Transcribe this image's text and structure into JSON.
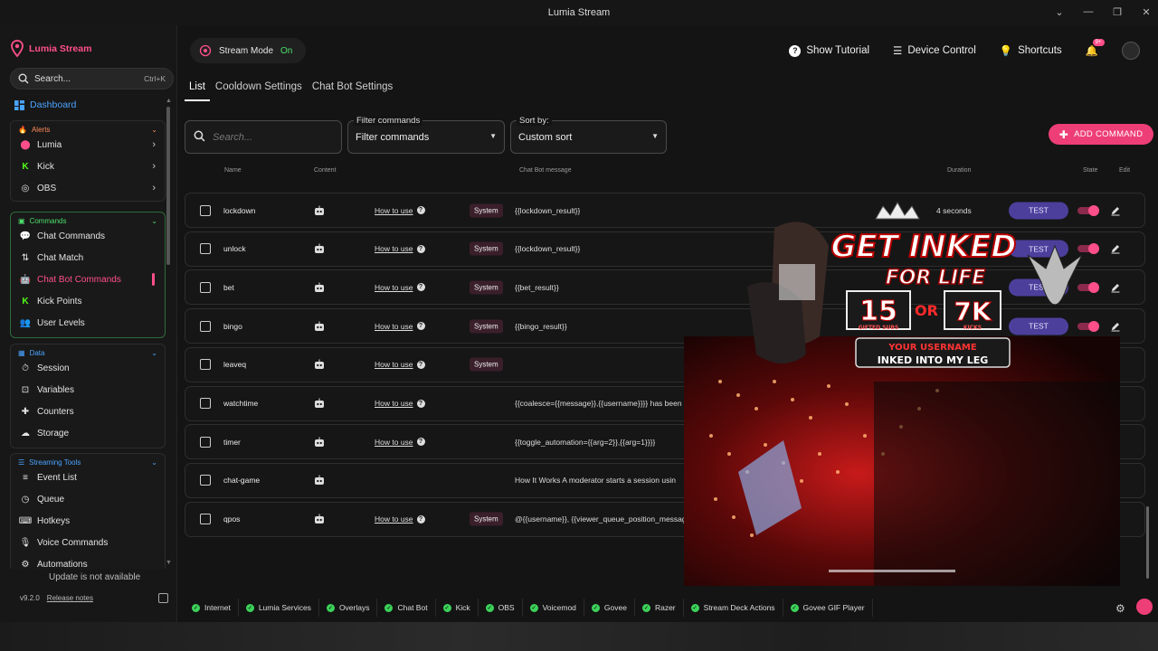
{
  "window": {
    "title": "Lumia Stream",
    "controls": [
      "chevron-down",
      "minimize",
      "restore",
      "close"
    ]
  },
  "sidebar": {
    "brand": "Lumia Stream",
    "search": {
      "placeholder": "Search...",
      "shortcut": "Ctrl+K"
    },
    "dashboard": "Dashboard",
    "groups": {
      "alerts": {
        "label": "Alerts",
        "items": [
          "Lumia",
          "Kick",
          "OBS"
        ]
      },
      "commands": {
        "label": "Commands",
        "items": [
          "Chat Commands",
          "Chat Match",
          "Chat Bot Commands",
          "Kick Points",
          "User Levels"
        ],
        "active": "Chat Bot Commands"
      },
      "data": {
        "label": "Data",
        "items": [
          "Session",
          "Variables",
          "Counters",
          "Storage"
        ]
      },
      "streaming": {
        "label": "Streaming Tools",
        "items": [
          "Event List",
          "Queue",
          "Hotkeys",
          "Voice Commands",
          "Automations"
        ]
      }
    },
    "update_text": "Update is not available",
    "version": "v9.2.0",
    "release_notes": "Release notes"
  },
  "header": {
    "stream_mode_label": "Stream Mode",
    "stream_mode_state": "On",
    "show_tutorial": "Show Tutorial",
    "device_control": "Device Control",
    "shortcuts": "Shortcuts",
    "notif_badge": "9+"
  },
  "tabs": [
    "List",
    "Cooldown Settings",
    "Chat Bot Settings"
  ],
  "filters": {
    "search_placeholder": "Search...",
    "filter_label": "Filter commands",
    "filter_value": "Filter commands",
    "sort_label": "Sort by:",
    "sort_value": "Custom sort",
    "add_button": "ADD COMMAND"
  },
  "table": {
    "columns": {
      "name": "Name",
      "content": "Content",
      "message": "Chat Bot message",
      "duration": "Duration",
      "state": "State",
      "edit": "Edit"
    },
    "howto": "How to use",
    "system": "System",
    "test": "TEST",
    "rows": [
      {
        "name": "lockdown",
        "howto": true,
        "system": true,
        "message": "{{lockdown_result}}",
        "duration": "4 seconds"
      },
      {
        "name": "unlock",
        "howto": true,
        "system": true,
        "message": "{{lockdown_result}}",
        "duration": ""
      },
      {
        "name": "bet",
        "howto": true,
        "system": true,
        "message": "{{bet_result}}",
        "duration": ""
      },
      {
        "name": "bingo",
        "howto": true,
        "system": true,
        "message": "{{bingo_result}}",
        "duration": ""
      },
      {
        "name": "leaveq",
        "howto": true,
        "system": true,
        "message": "",
        "duration": ""
      },
      {
        "name": "watchtime",
        "howto": true,
        "system": false,
        "message": "{{coalesce={{message}},{{username}}}} has been wa",
        "duration": ""
      },
      {
        "name": "timer",
        "howto": true,
        "system": false,
        "message": "{{toggle_automation={{arg=2}},{{arg=1}}}}",
        "duration": ""
      },
      {
        "name": "chat-game",
        "howto": false,
        "system": false,
        "message": "How It Works A moderator starts a session usin",
        "duration": ""
      },
      {
        "name": "qpos",
        "howto": true,
        "system": true,
        "message": "@{{username}}, {{viewer_queue_position_message}",
        "duration": ""
      }
    ]
  },
  "overlay": {
    "headline_1": "GET INKED",
    "headline_2": "FOR LIFE",
    "stat_1": "15",
    "stat_1_label": "GIFTED SUBS",
    "or_text": "OR",
    "stat_2": "7K",
    "stat_2_label": "KICKS",
    "caption_1": "YOUR USERNAME",
    "caption_2": "INKED INTO MY LEG"
  },
  "statusbar": [
    "Internet",
    "Lumia Services",
    "Overlays",
    "Chat Bot",
    "Kick",
    "OBS",
    "Voicemod",
    "Govee",
    "Razer",
    "Stream Deck Actions",
    "Govee GIF Player"
  ],
  "colors": {
    "accent": "#ff4f8b",
    "status_ok": "#3cd25a",
    "test_button": "#4c3f9c",
    "link_blue": "#4aa3ff"
  }
}
